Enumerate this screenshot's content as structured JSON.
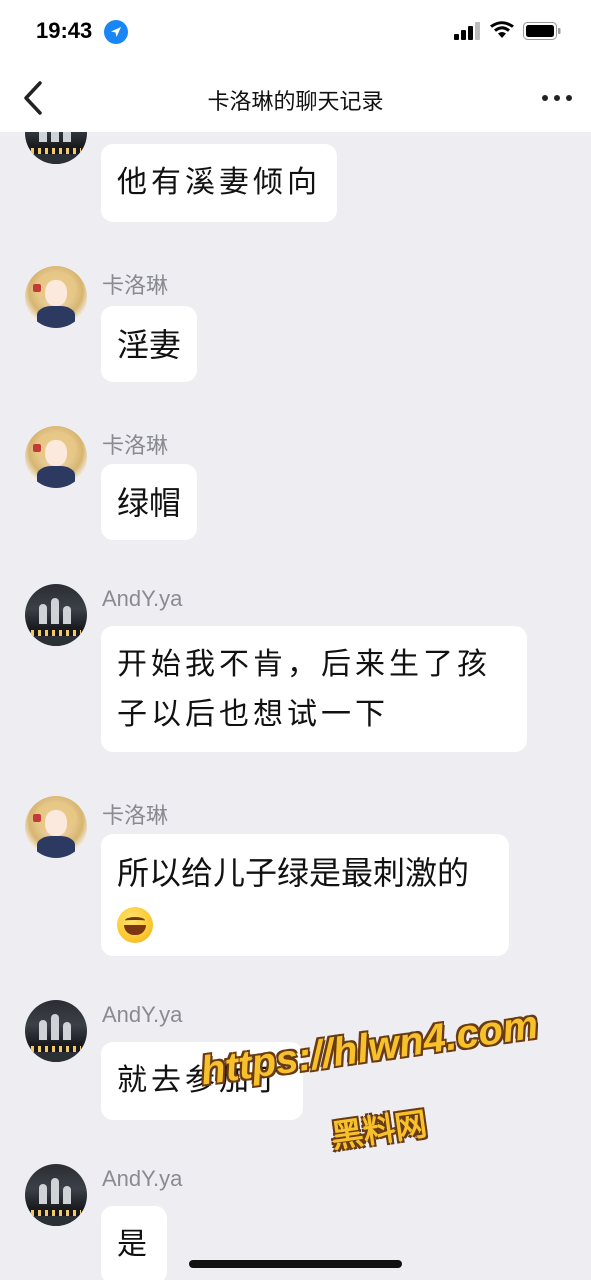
{
  "status_bar": {
    "time": "19:43"
  },
  "nav": {
    "title": "卡洛琳的聊天记录"
  },
  "messages": [
    {
      "sender": "",
      "text": "他有溪妻倾向"
    },
    {
      "sender": "卡洛琳",
      "text": "淫妻"
    },
    {
      "sender": "卡洛琳",
      "text": "绿帽"
    },
    {
      "sender": "AndY.ya",
      "line1": "开始我不肯，后来生了孩",
      "line2": "子以后也想试一下"
    },
    {
      "sender": "卡洛琳",
      "line1": "所以给儿子绿是最刺激的"
    },
    {
      "sender": "AndY.ya",
      "text": "就去参加了"
    },
    {
      "sender": "AndY.ya",
      "text": "是"
    }
  ],
  "watermark": {
    "url": "https://hlwn4.com",
    "site": "黑料网"
  },
  "colors": {
    "chat_background": "#ededf2",
    "bubble": "#ffffff",
    "sender_name": "#8a8a92",
    "location_icon": "#1a86f5",
    "watermark": "#f6c12a"
  }
}
